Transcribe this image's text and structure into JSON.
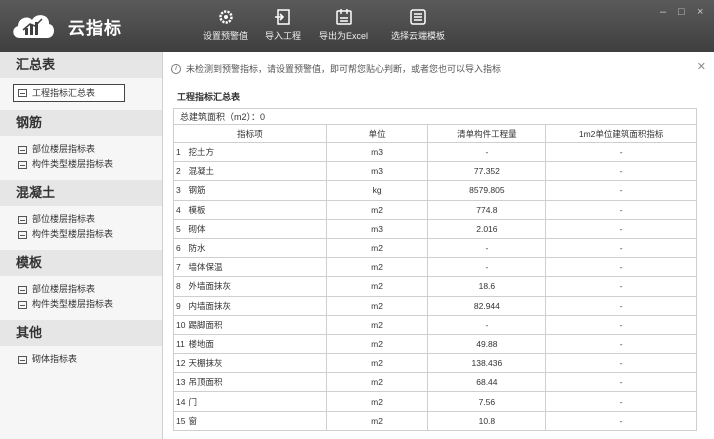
{
  "app": {
    "title": "云指标"
  },
  "toolbar": [
    {
      "label": "设置预警值",
      "icon": "gear-icon"
    },
    {
      "label": "导入工程",
      "icon": "import-icon"
    },
    {
      "label": "导出为Excel",
      "icon": "export-excel-icon"
    },
    {
      "label": "选择云端模板",
      "icon": "cloud-template-icon"
    }
  ],
  "window": {
    "minimize": "–",
    "maximize": "□",
    "close": "×"
  },
  "sidebar": {
    "sections": [
      {
        "title": "汇总表",
        "items": [
          "工程指标汇总表"
        ]
      },
      {
        "title": "钢筋",
        "items": [
          "部位楼层指标表",
          "构件类型楼层指标表"
        ]
      },
      {
        "title": "混凝土",
        "items": [
          "部位楼层指标表",
          "构件类型楼层指标表"
        ]
      },
      {
        "title": "模板",
        "items": [
          "部位楼层指标表",
          "构件类型楼层指标表"
        ]
      },
      {
        "title": "其他",
        "items": [
          "砌体指标表"
        ]
      }
    ]
  },
  "main": {
    "notice": "未检测到预警指标，请设置预警值，即可帮您贴心判断，或者您也可以导入指标",
    "sheet_title": "工程指标汇总表",
    "area_label": "总建筑面积（m2）：0",
    "columns": [
      "指标项",
      "单位",
      "清单构件工程量",
      "1m2单位建筑面积指标"
    ],
    "rows": [
      {
        "no": "1",
        "name": "挖土方",
        "unit": "m3",
        "qty": "-",
        "per": "-"
      },
      {
        "no": "2",
        "name": "混凝土",
        "unit": "m3",
        "qty": "77.352",
        "per": "-"
      },
      {
        "no": "3",
        "name": "钢筋",
        "unit": "kg",
        "qty": "8579.805",
        "per": "-"
      },
      {
        "no": "4",
        "name": "模板",
        "unit": "m2",
        "qty": "774.8",
        "per": "-"
      },
      {
        "no": "5",
        "name": "砌体",
        "unit": "m3",
        "qty": "2.016",
        "per": "-"
      },
      {
        "no": "6",
        "name": "防水",
        "unit": "m2",
        "qty": "-",
        "per": "-"
      },
      {
        "no": "7",
        "name": "墙体保温",
        "unit": "m2",
        "qty": "-",
        "per": "-"
      },
      {
        "no": "8",
        "name": "外墙面抹灰",
        "unit": "m2",
        "qty": "18.6",
        "per": "-"
      },
      {
        "no": "9",
        "name": "内墙面抹灰",
        "unit": "m2",
        "qty": "82.944",
        "per": "-"
      },
      {
        "no": "10",
        "name": "踢脚面积",
        "unit": "m2",
        "qty": "-",
        "per": "-"
      },
      {
        "no": "11",
        "name": "楼地面",
        "unit": "m2",
        "qty": "49.88",
        "per": "-"
      },
      {
        "no": "12",
        "name": "天棚抹灰",
        "unit": "m2",
        "qty": "138.436",
        "per": "-"
      },
      {
        "no": "13",
        "name": "吊顶面积",
        "unit": "m2",
        "qty": "68.44",
        "per": "-"
      },
      {
        "no": "14",
        "name": "门",
        "unit": "m2",
        "qty": "7.56",
        "per": "-"
      },
      {
        "no": "15",
        "name": "窗",
        "unit": "m2",
        "qty": "10.8",
        "per": "-"
      }
    ]
  }
}
